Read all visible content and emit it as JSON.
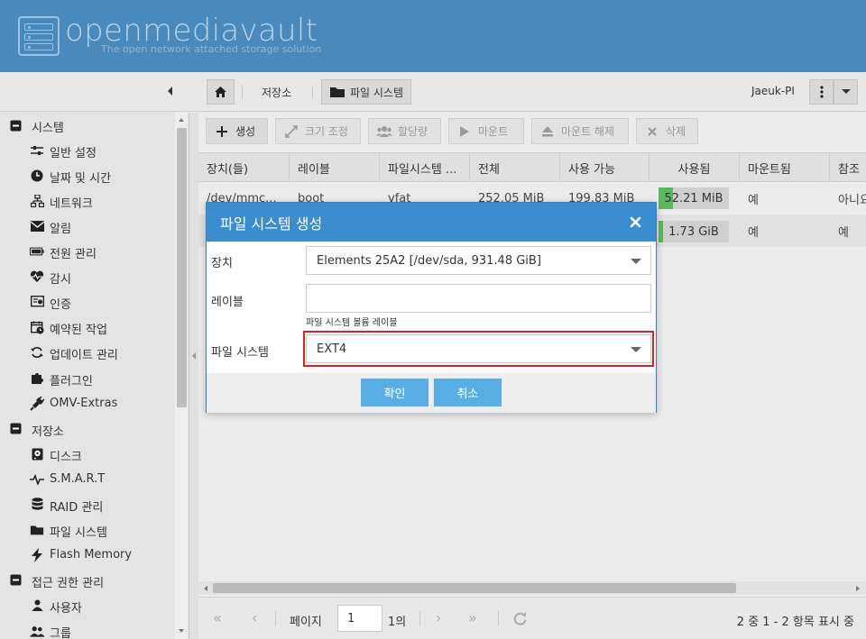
{
  "header": {
    "logo_text": "openmediavault",
    "logo_sub": "The open network attached storage solution"
  },
  "breadcrumb": {
    "items": [
      "저장소",
      "파일 시스템"
    ]
  },
  "host": "Jaeuk-PI",
  "sidebar": {
    "items": [
      {
        "label": "시스템",
        "icon": "minus-square-icon",
        "level": 0
      },
      {
        "label": "일반 설정",
        "icon": "sliders-icon",
        "level": 1
      },
      {
        "label": "날짜 및 시간",
        "icon": "clock-icon",
        "level": 1
      },
      {
        "label": "네트워크",
        "icon": "network-icon",
        "level": 1
      },
      {
        "label": "알림",
        "icon": "envelope-icon",
        "level": 1
      },
      {
        "label": "전원 관리",
        "icon": "battery-icon",
        "level": 1
      },
      {
        "label": "감시",
        "icon": "heartbeat-icon",
        "level": 1
      },
      {
        "label": "인증",
        "icon": "certificate-icon",
        "level": 1
      },
      {
        "label": "예약된 작업",
        "icon": "calendar-clock-icon",
        "level": 1
      },
      {
        "label": "업데이트 관리",
        "icon": "refresh-icon",
        "level": 1
      },
      {
        "label": "플러그인",
        "icon": "puzzle-icon",
        "level": 1
      },
      {
        "label": "OMV-Extras",
        "icon": "plug-icon",
        "level": 1
      },
      {
        "label": "저장소",
        "icon": "minus-square-icon",
        "level": 0
      },
      {
        "label": "디스크",
        "icon": "disk-icon",
        "level": 1
      },
      {
        "label": "S.M.A.R.T",
        "icon": "pulse-icon",
        "level": 1
      },
      {
        "label": "RAID 관리",
        "icon": "database-icon",
        "level": 1
      },
      {
        "label": "파일 시스템",
        "icon": "folder-icon",
        "level": 1
      },
      {
        "label": "Flash Memory",
        "icon": "bolt-icon",
        "level": 1
      },
      {
        "label": "접근 권한 관리",
        "icon": "minus-square-icon",
        "level": 0
      },
      {
        "label": "사용자",
        "icon": "user-icon",
        "level": 1
      },
      {
        "label": "그룹",
        "icon": "users-icon",
        "level": 1
      }
    ]
  },
  "toolbar": {
    "create": "생성",
    "resize": "크기 조정",
    "quota": "할당량",
    "mount": "마운트",
    "unmount": "마운트 해제",
    "delete": "삭제"
  },
  "grid": {
    "columns": [
      "장치(들)",
      "레이블",
      "파일시스템 ...",
      "전체",
      "사용 가능",
      "사용됨",
      "마운트됨",
      "참조"
    ],
    "rows": [
      {
        "device": "/dev/mmc...",
        "label": "boot",
        "fs": "vfat",
        "total": "252.05 MiB",
        "avail": "199.83 MiB",
        "used": "52.21 MiB",
        "used_pct": 0.21,
        "mounted": "예",
        "ref": "아니요"
      },
      {
        "device": "",
        "label": "",
        "fs": "",
        "total": "",
        "avail": "",
        "used": "1.73 GiB",
        "used_pct": 0.06,
        "mounted": "예",
        "ref": "예"
      }
    ]
  },
  "pager": {
    "page_label": "페이지",
    "page_value": "1",
    "of_label": "1의",
    "status": "2 중 1 - 2 항목 표시 중"
  },
  "modal": {
    "title": "파일 시스템 생성",
    "device_label": "장치",
    "device_value": "Elements 25A2 [/dev/sda, 931.48 GiB]",
    "label_label": "레이블",
    "label_value": "",
    "label_hint": "파일 시스템 볼륨 레이블",
    "fs_label": "파일 시스템",
    "fs_value": "EXT4",
    "ok": "확인",
    "cancel": "취소"
  },
  "colors": {
    "header": "#4a89bb",
    "modal_title": "#3c8cd0",
    "modal_button": "#5aaee6",
    "usage_fill": "#5cb85c",
    "highlight": "#e02020"
  }
}
